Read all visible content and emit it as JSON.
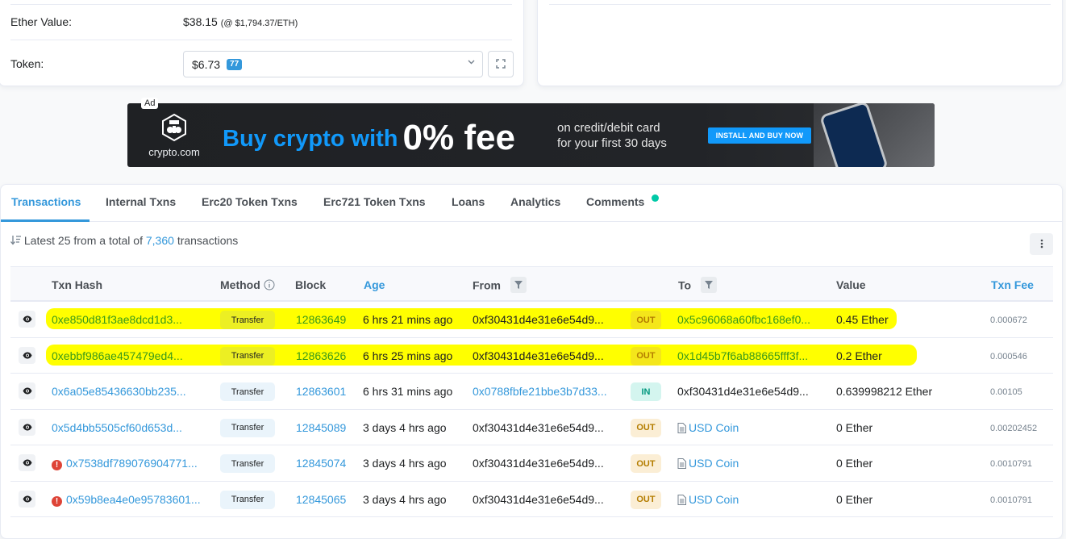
{
  "overview": {
    "ether_value_label": "Ether Value:",
    "ether_value": "$38.15",
    "ether_price": "(@ $1,794.37/ETH)",
    "token_label": "Token:",
    "token_value": "$6.73",
    "token_count": "77"
  },
  "ad": {
    "label": "Ad",
    "brand": "crypto.com",
    "headline": "Buy crypto with",
    "headline_big": "0% fee",
    "sub_line1": "on credit/debit card",
    "sub_line2": "for your first 30 days",
    "cta": "INSTALL AND BUY NOW"
  },
  "tabs": [
    {
      "label": "Transactions",
      "active": true
    },
    {
      "label": "Internal Txns"
    },
    {
      "label": "Erc20 Token Txns"
    },
    {
      "label": "Erc721 Token Txns"
    },
    {
      "label": "Loans"
    },
    {
      "label": "Analytics"
    },
    {
      "label": "Comments"
    }
  ],
  "summary": {
    "prefix": "Latest 25 from a total of",
    "total": "7,360",
    "suffix": "transactions"
  },
  "table": {
    "headers": {
      "txn_hash": "Txn Hash",
      "method": "Method",
      "block": "Block",
      "age": "Age",
      "from": "From",
      "to": "To",
      "value": "Value",
      "txn_fee": "Txn Fee"
    },
    "rows": [
      {
        "hash": "0xe850d81f3ae8dcd1d3...",
        "method": "Transfer",
        "block": "12863649",
        "age": "6 hrs 21 mins ago",
        "from": "0xf30431d4e31e6e54d9...",
        "direction": "OUT",
        "to": "0x5c96068a60fbc168ef0...",
        "value": "0.45 Ether",
        "fee": "0.000672",
        "highlighted": true
      },
      {
        "hash": "0xebbf986ae457479ed4...",
        "method": "Transfer",
        "block": "12863626",
        "age": "6 hrs 25 mins ago",
        "from": "0xf30431d4e31e6e54d9...",
        "direction": "OUT",
        "to": "0x1d45b7f6ab88665fff3f...",
        "value": "0.2 Ether",
        "fee": "0.000546",
        "highlighted": true
      },
      {
        "hash": "0x6a05e85436630bb235...",
        "method": "Transfer",
        "block": "12863601",
        "age": "6 hrs 31 mins ago",
        "from": "0x0788fbfe21bbe3b7d33...",
        "direction": "IN",
        "to": "0xf30431d4e31e6e54d9...",
        "value": "0.639998212 Ether",
        "fee": "0.00105"
      },
      {
        "hash": "0x5d4bb5505cf60d653d...",
        "method": "Transfer",
        "block": "12845089",
        "age": "3 days 4 hrs ago",
        "from": "0xf30431d4e31e6e54d9...",
        "direction": "OUT",
        "to": "USD Coin",
        "value": "0 Ether",
        "fee": "0.00202452"
      },
      {
        "hash": "0x7538df789076904771...",
        "method": "Transfer",
        "block": "12845074",
        "age": "3 days 4 hrs ago",
        "from": "0xf30431d4e31e6e54d9...",
        "direction": "OUT",
        "to": "USD Coin",
        "value": "0 Ether",
        "fee": "0.0010791",
        "error": true
      },
      {
        "hash": "0x59b8ea4e0e95783601...",
        "method": "Transfer",
        "block": "12845065",
        "age": "3 days 4 hrs ago",
        "from": "0xf30431d4e31e6e54d9...",
        "direction": "OUT",
        "to": "USD Coin",
        "value": "0 Ether",
        "fee": "0.0010791",
        "error": true
      }
    ]
  },
  "colors": {
    "accent": "#3498db",
    "highlight": "#ffff00",
    "out_badge": "#fbeed5",
    "in_badge": "#d4f5ef",
    "error": "#de4437",
    "comments_dot": "#00c9a7"
  }
}
